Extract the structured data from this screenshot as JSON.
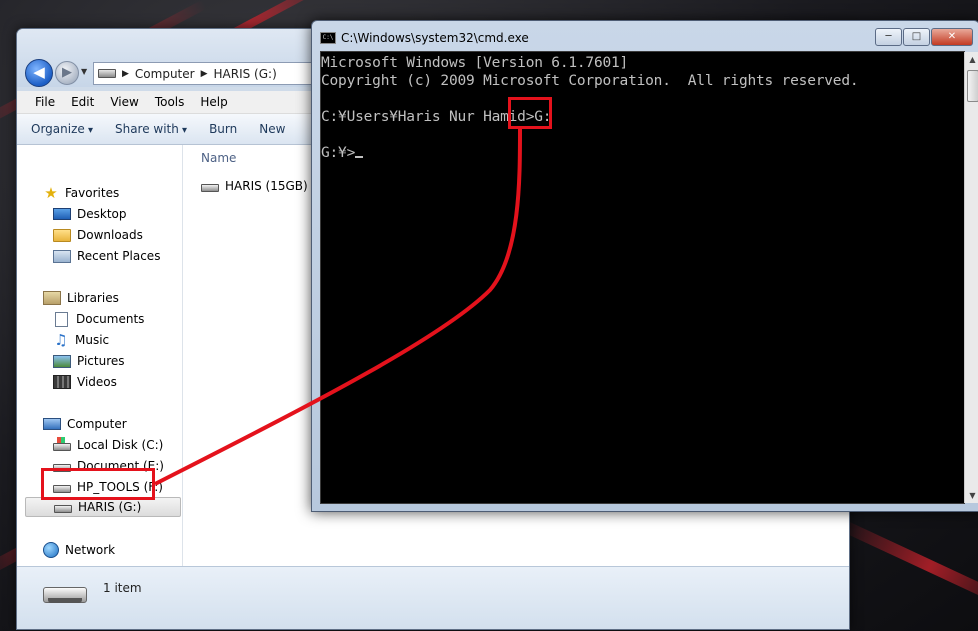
{
  "explorer": {
    "address": {
      "segments": [
        "Computer",
        "HARIS (G:)"
      ]
    },
    "menu": [
      "File",
      "Edit",
      "View",
      "Tools",
      "Help"
    ],
    "commands": {
      "organize": "Organize",
      "share_with": "Share with",
      "burn": "Burn",
      "new_folder": "New"
    },
    "nav": {
      "favorites": "Favorites",
      "desktop": "Desktop",
      "downloads": "Downloads",
      "recent": "Recent Places",
      "libraries": "Libraries",
      "documents": "Documents",
      "music": "Music",
      "pictures": "Pictures",
      "videos": "Videos",
      "computer": "Computer",
      "drive_c": "Local Disk (C:)",
      "drive_e": "Document (E:)",
      "drive_f": "HP_TOOLS (F:)",
      "drive_g": "HARIS (G:)",
      "network": "Network"
    },
    "content": {
      "column_name": "Name",
      "item": "HARIS (15GB)"
    },
    "details": {
      "count": "1 item"
    }
  },
  "cmd": {
    "title": "C:\\Windows\\system32\\cmd.exe",
    "icon_label": "C:\\",
    "lines": [
      "Microsoft Windows [Version 6.1.7601]",
      "Copyright (c) 2009 Microsoft Corporation.  All rights reserved.",
      "",
      "C:¥Users¥Haris Nur Hamid>G:",
      "",
      "G:¥>"
    ]
  },
  "annotation": {
    "color": "#e4121c"
  }
}
